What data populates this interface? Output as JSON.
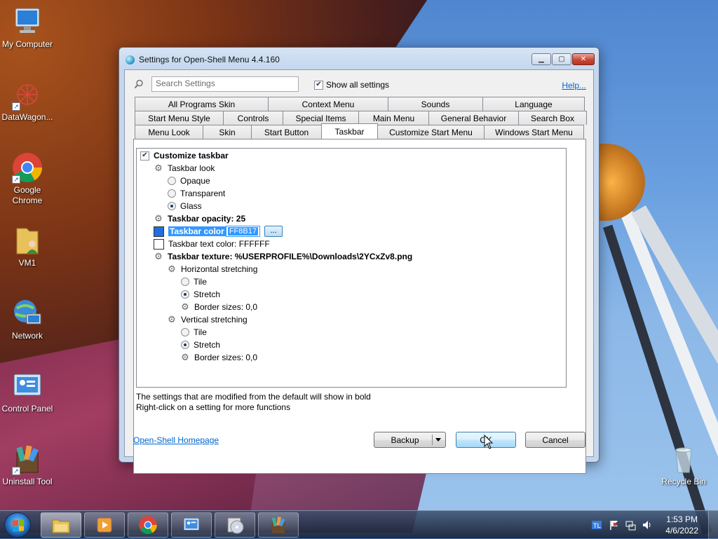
{
  "desktop": {
    "icons": [
      {
        "label": "My Computer",
        "icon": "computer-icon"
      },
      {
        "label": "DataWagon...",
        "icon": "datawagon-icon"
      },
      {
        "label": "Google Chrome",
        "icon": "chrome-icon"
      },
      {
        "label": "VM1",
        "icon": "user-folder-icon"
      },
      {
        "label": "Network",
        "icon": "network-icon"
      },
      {
        "label": "Control Panel",
        "icon": "control-panel-icon"
      },
      {
        "label": "Uninstall Tool",
        "icon": "uninstall-tool-icon"
      },
      {
        "label": "Recycle Bin",
        "icon": "recycle-bin-icon"
      }
    ]
  },
  "dialog": {
    "title": "Settings for Open-Shell Menu 4.4.160",
    "search_placeholder": "Search Settings",
    "show_all_label": "Show all settings",
    "show_all_checked": true,
    "help_label": "Help...",
    "tabs_row1": [
      "All Programs Skin",
      "Context Menu",
      "Sounds",
      "Language"
    ],
    "tabs_row2": [
      "Start Menu Style",
      "Controls",
      "Special Items",
      "Main Menu",
      "General Behavior",
      "Search Box"
    ],
    "tabs_row3": [
      "Menu Look",
      "Skin",
      "Start Button",
      "Taskbar",
      "Customize Start Menu",
      "Windows Start Menu"
    ],
    "active_tab": "Taskbar",
    "tree": {
      "customize_taskbar": "Customize taskbar",
      "taskbar_look": "Taskbar look",
      "opaque": "Opaque",
      "transparent": "Transparent",
      "glass": "Glass",
      "opacity": "Taskbar opacity: 25",
      "color_label": "Taskbar color",
      "color_value": "FF8B17",
      "color_button": "...",
      "text_color": "Taskbar text color: FFFFFF",
      "texture": "Taskbar texture: %USERPROFILE%\\Downloads\\2YCxZv8.png",
      "horizontal_stretching": "Horizontal stretching",
      "h_tile": "Tile",
      "h_stretch": "Stretch",
      "h_border": "Border sizes: 0,0",
      "vertical_stretching": "Vertical stretching",
      "v_tile": "Tile",
      "v_stretch": "Stretch",
      "v_border": "Border sizes: 0,0"
    },
    "note1": "The settings that are modified from the default will show in bold",
    "note2": "Right-click on a setting for more functions",
    "homepage_link": "Open-Shell Homepage",
    "backup_label": "Backup",
    "ok_label": "OK",
    "cancel_label": "Cancel"
  },
  "colors": {
    "taskbar_color_swatch": "#1f6fe0",
    "text_color_swatch": "#ffffff",
    "accent": "#3399ff"
  },
  "taskbar": {
    "pinned": [
      "file-explorer-icon",
      "media-player-icon",
      "chrome-icon",
      "control-panel-icon",
      "cd-burner-icon",
      "uninstall-tool-icon"
    ],
    "time": "1:53 PM",
    "date": "4/6/2022",
    "tray_icons": [
      "app-tray-icon",
      "flag-icon",
      "network-tray-icon",
      "volume-icon"
    ]
  }
}
